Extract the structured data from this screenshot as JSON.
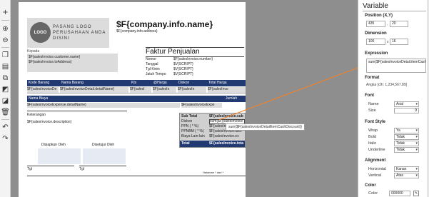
{
  "toolbar": {
    "buttons": [
      "add-icon",
      "zoom-in-icon",
      "zoom-out-icon",
      "copy-icon",
      "paste-icon",
      "clone-icon",
      "front-icon",
      "back-icon",
      "delete-icon",
      "undo-icon",
      "redo-icon"
    ]
  },
  "report": {
    "logo_text": "LOGO",
    "logo_caption": "PASANG LOGO PERUSAHAAN ANDA DISINI",
    "company_name": "$F{company.info.name}",
    "company_address": "$F{company.info.address}",
    "kepada_label": "Kepada",
    "customer_name": "$F{salesInvoice.customer.name}",
    "to_address": "$F{salesInvoice.toAddress}",
    "faktur_title": "Faktur Penjualan",
    "info_labels": [
      "Nomor",
      "Tanggal",
      "Tgl Kirim",
      "Jatuh Tempo"
    ],
    "info_values": [
      "$F{salesInvoice.number}",
      "$V{SCRIPT}",
      "$V{SCRIPT}",
      "$V{SCRIPT}"
    ],
    "item_header": [
      "Kode Barang",
      "Nama Barang",
      "Kts",
      "@Harga",
      "Diskon",
      "Total Harga"
    ],
    "item_row": [
      "$F{salesInvoiceDe",
      "$F{salesInvoiceDetail.detailName}",
      "$F{salesI",
      "$F{salesIn",
      "$F{salesIn",
      "$F{salesInvo"
    ],
    "expense_header": [
      "Nama Biaya",
      "Jumlah"
    ],
    "expense_row": [
      "$F{salesInvoiceExpense.detailName}",
      "$F{salesInvoiceExpe"
    ],
    "keterangan_label": "Keterangan",
    "description": "$F{salesInvoice.description}",
    "summary_header": [
      "Sub Total",
      "$F{salesInvoice.sub"
    ],
    "summary_rows": [
      [
        "Diskon",
        "sum($F{salesInvoice"
      ],
      [
        "PPN ( * %)",
        "$F{salesInvoice.tax1"
      ],
      [
        "PPNBM ( * %)",
        "$F{salesInvoice.tax2"
      ],
      [
        "Biaya Lain-lain",
        "$F{salesInvoice.ex"
      ]
    ],
    "summary_total": [
      "Total",
      "$F{salesInvoice.tota"
    ],
    "disiapkan_label": "Disiapkan Oleh",
    "disetujui_label": "Disetujui Oleh",
    "tgl_left": "Tgl",
    "tgl_right": "Tgl",
    "footer_text": "Halaman * dari *"
  },
  "tooltip": "sum($F{salesInvoiceDetailItemCashDiscount})",
  "panel": {
    "title": "Variable",
    "position_label": "Position (X,Y)",
    "pos_x": "435",
    "pos_y": "20",
    "dimension_label": "Dimension",
    "dim_w": "100",
    "dim_h": "16",
    "expression_label": "Expression",
    "expression_value": "sum($F{salesInvoiceDetail.itemCashDiscount})",
    "format_label": "Format",
    "format_value": "Angka [cth: 1,234,567.89]",
    "font_label": "Font",
    "font_name_label": "Name",
    "font_name_value": "Arial",
    "font_size_label": "Size",
    "font_size_value": "9",
    "font_style_label": "Font Style",
    "wrap_label": "Wrap",
    "wrap_value": "Ya",
    "bold_label": "Bold",
    "bold_value": "Tidak",
    "italic_label": "Italic",
    "italic_value": "Tidak",
    "underline_label": "Underline",
    "underline_value": "Tidak",
    "alignment_label": "Alignment",
    "horizontal_label": "Horizontal",
    "horizontal_value": "Kanan",
    "vertical_label": "Vertical",
    "vertical_value": "Atas",
    "color_label": "Color",
    "color_row_label": "Color",
    "color_value": "000000"
  },
  "colors": {
    "band": "#213a72",
    "connector": "#f0822a"
  }
}
